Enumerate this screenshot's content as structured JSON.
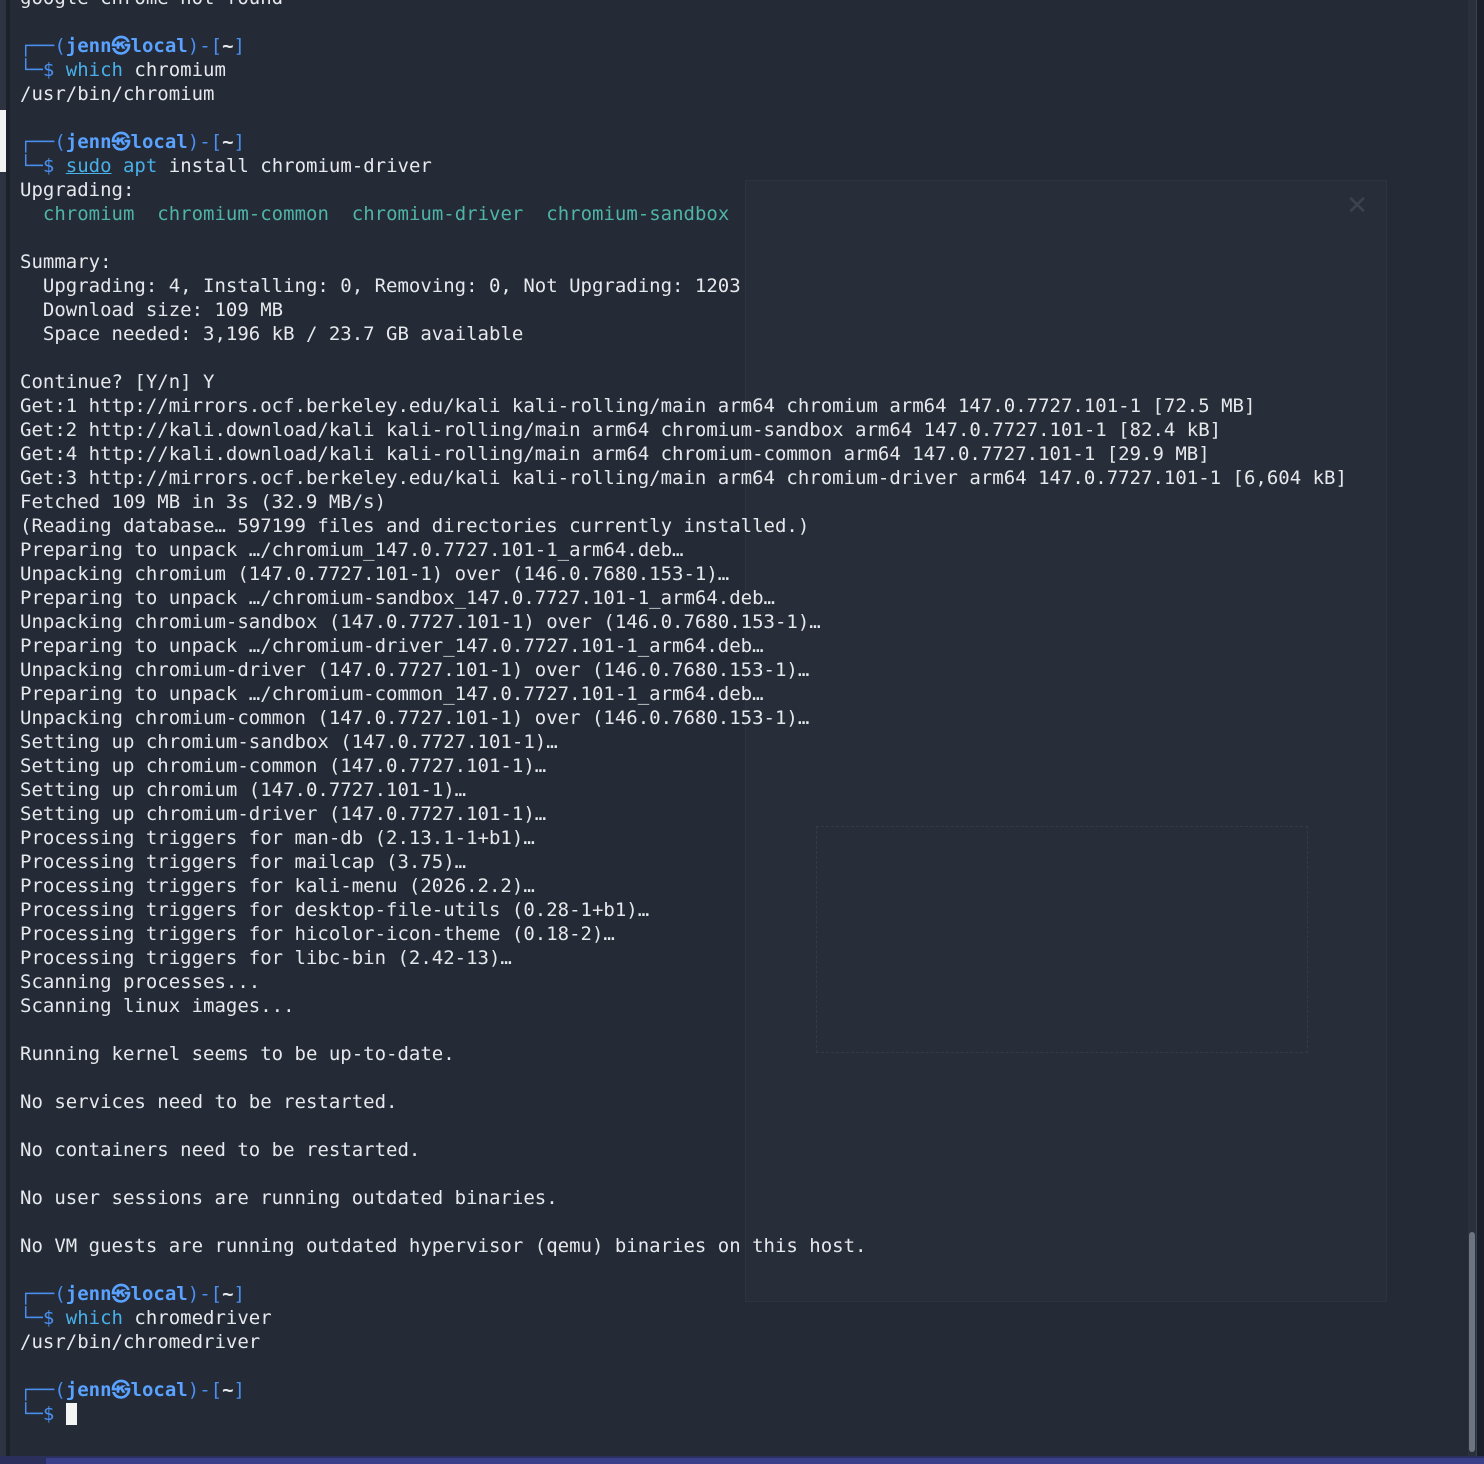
{
  "prompt": {
    "user": "jenn",
    "at_glyph": "㉿",
    "host": "local",
    "dir": "~",
    "frame_top_left": "┌──(",
    "frame_mid": ")-[",
    "frame_top_right": "]",
    "frame_bottom": "└─$ "
  },
  "lines": [
    {
      "type": "text",
      "text": "google-chrome not found"
    },
    {
      "type": "blank"
    },
    {
      "type": "prompt"
    },
    {
      "type": "cmd",
      "parts": [
        {
          "cls": "c-cmd",
          "t": "which"
        },
        {
          "cls": "c-arg",
          "t": " chromium"
        }
      ]
    },
    {
      "type": "text",
      "text": "/usr/bin/chromium"
    },
    {
      "type": "blank"
    },
    {
      "type": "prompt"
    },
    {
      "type": "cmd",
      "parts": [
        {
          "cls": "c-sudo",
          "t": "sudo"
        },
        {
          "cls": "c-arg",
          "t": " "
        },
        {
          "cls": "c-cmd",
          "t": "apt"
        },
        {
          "cls": "c-arg",
          "t": " install chromium-driver"
        }
      ]
    },
    {
      "type": "text",
      "text": "Upgrading:"
    },
    {
      "type": "pkgs",
      "items": [
        "chromium",
        "chromium-common",
        "chromium-driver",
        "chromium-sandbox"
      ]
    },
    {
      "type": "blank"
    },
    {
      "type": "text",
      "text": "Summary:"
    },
    {
      "type": "text",
      "text": "  Upgrading: 4, Installing: 0, Removing: 0, Not Upgrading: 1203"
    },
    {
      "type": "text",
      "text": "  Download size: 109 MB"
    },
    {
      "type": "text",
      "text": "  Space needed: 3,196 kB / 23.7 GB available"
    },
    {
      "type": "blank"
    },
    {
      "type": "text",
      "text": "Continue? [Y/n] Y"
    },
    {
      "type": "text",
      "text": "Get:1 http://mirrors.ocf.berkeley.edu/kali kali-rolling/main arm64 chromium arm64 147.0.7727.101-1 [72.5 MB]"
    },
    {
      "type": "text",
      "text": "Get:2 http://kali.download/kali kali-rolling/main arm64 chromium-sandbox arm64 147.0.7727.101-1 [82.4 kB]"
    },
    {
      "type": "text",
      "text": "Get:4 http://kali.download/kali kali-rolling/main arm64 chromium-common arm64 147.0.7727.101-1 [29.9 MB]"
    },
    {
      "type": "text",
      "text": "Get:3 http://mirrors.ocf.berkeley.edu/kali kali-rolling/main arm64 chromium-driver arm64 147.0.7727.101-1 [6,604 kB]"
    },
    {
      "type": "text",
      "text": "Fetched 109 MB in 3s (32.9 MB/s)"
    },
    {
      "type": "text",
      "text": "(Reading database… 597199 files and directories currently installed.)"
    },
    {
      "type": "text",
      "text": "Preparing to unpack …/chromium_147.0.7727.101-1_arm64.deb…"
    },
    {
      "type": "text",
      "text": "Unpacking chromium (147.0.7727.101-1) over (146.0.7680.153-1)…"
    },
    {
      "type": "text",
      "text": "Preparing to unpack …/chromium-sandbox_147.0.7727.101-1_arm64.deb…"
    },
    {
      "type": "text",
      "text": "Unpacking chromium-sandbox (147.0.7727.101-1) over (146.0.7680.153-1)…"
    },
    {
      "type": "text",
      "text": "Preparing to unpack …/chromium-driver_147.0.7727.101-1_arm64.deb…"
    },
    {
      "type": "text",
      "text": "Unpacking chromium-driver (147.0.7727.101-1) over (146.0.7680.153-1)…"
    },
    {
      "type": "text",
      "text": "Preparing to unpack …/chromium-common_147.0.7727.101-1_arm64.deb…"
    },
    {
      "type": "text",
      "text": "Unpacking chromium-common (147.0.7727.101-1) over (146.0.7680.153-1)…"
    },
    {
      "type": "text",
      "text": "Setting up chromium-sandbox (147.0.7727.101-1)…"
    },
    {
      "type": "text",
      "text": "Setting up chromium-common (147.0.7727.101-1)…"
    },
    {
      "type": "text",
      "text": "Setting up chromium (147.0.7727.101-1)…"
    },
    {
      "type": "text",
      "text": "Setting up chromium-driver (147.0.7727.101-1)…"
    },
    {
      "type": "text",
      "text": "Processing triggers for man-db (2.13.1-1+b1)…"
    },
    {
      "type": "text",
      "text": "Processing triggers for mailcap (3.75)…"
    },
    {
      "type": "text",
      "text": "Processing triggers for kali-menu (2026.2.2)…"
    },
    {
      "type": "text",
      "text": "Processing triggers for desktop-file-utils (0.28-1+b1)…"
    },
    {
      "type": "text",
      "text": "Processing triggers for hicolor-icon-theme (0.18-2)…"
    },
    {
      "type": "text",
      "text": "Processing triggers for libc-bin (2.42-13)…"
    },
    {
      "type": "text",
      "text": "Scanning processes..."
    },
    {
      "type": "text",
      "text": "Scanning linux images..."
    },
    {
      "type": "blank"
    },
    {
      "type": "text",
      "text": "Running kernel seems to be up-to-date."
    },
    {
      "type": "blank"
    },
    {
      "type": "text",
      "text": "No services need to be restarted."
    },
    {
      "type": "blank"
    },
    {
      "type": "text",
      "text": "No containers need to be restarted."
    },
    {
      "type": "blank"
    },
    {
      "type": "text",
      "text": "No user sessions are running outdated binaries."
    },
    {
      "type": "blank"
    },
    {
      "type": "text",
      "text": "No VM guests are running outdated hypervisor (qemu) binaries on this host."
    },
    {
      "type": "blank"
    },
    {
      "type": "prompt"
    },
    {
      "type": "cmd",
      "parts": [
        {
          "cls": "c-cmd",
          "t": "which"
        },
        {
          "cls": "c-arg",
          "t": " chromedriver"
        }
      ]
    },
    {
      "type": "text",
      "text": "/usr/bin/chromedriver"
    },
    {
      "type": "blank"
    },
    {
      "type": "prompt"
    },
    {
      "type": "cursor"
    }
  ],
  "colors": {
    "background": "#242a36",
    "prompt_frame": "#4a8ff0",
    "command": "#49b0e8",
    "package": "#4fb4a8",
    "text": "#e6e8ec"
  }
}
